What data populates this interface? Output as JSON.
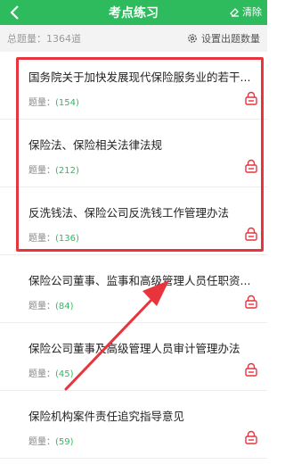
{
  "header": {
    "title": "考点练习",
    "clear_label": "清除"
  },
  "stats": {
    "total_label": "总题量：1364道",
    "settings_label": "设置出题数量"
  },
  "items": [
    {
      "title": "国务院关于加快发展现代保险服务业的若干...",
      "count_label": "题量：",
      "count": "(154)"
    },
    {
      "title": "保险法、保险相关法律法规",
      "count_label": "题量：",
      "count": "(212)"
    },
    {
      "title": "反洗钱法、保险公司反洗钱工作管理办法",
      "count_label": "题量：",
      "count": "(136)"
    },
    {
      "title": "保险公司董事、监事和高级管理人员任职资...",
      "count_label": "题量：",
      "count": "(84)"
    },
    {
      "title": "保险公司董事及高级管理人员审计管理办法",
      "count_label": "题量：",
      "count": "(45)"
    },
    {
      "title": "保险机构案件责任追究指导意见",
      "count_label": "题量：",
      "count": "(59)"
    }
  ],
  "colors": {
    "header_bg": "#2dbb5e",
    "accent_green": "#2dbb5e",
    "annotation_red": "#e8343c",
    "lock_red": "#e8343c"
  },
  "icons": {
    "back": "chevron-left-icon",
    "clear": "eraser-icon",
    "settings": "gear-icon",
    "lock": "lock-icon"
  }
}
